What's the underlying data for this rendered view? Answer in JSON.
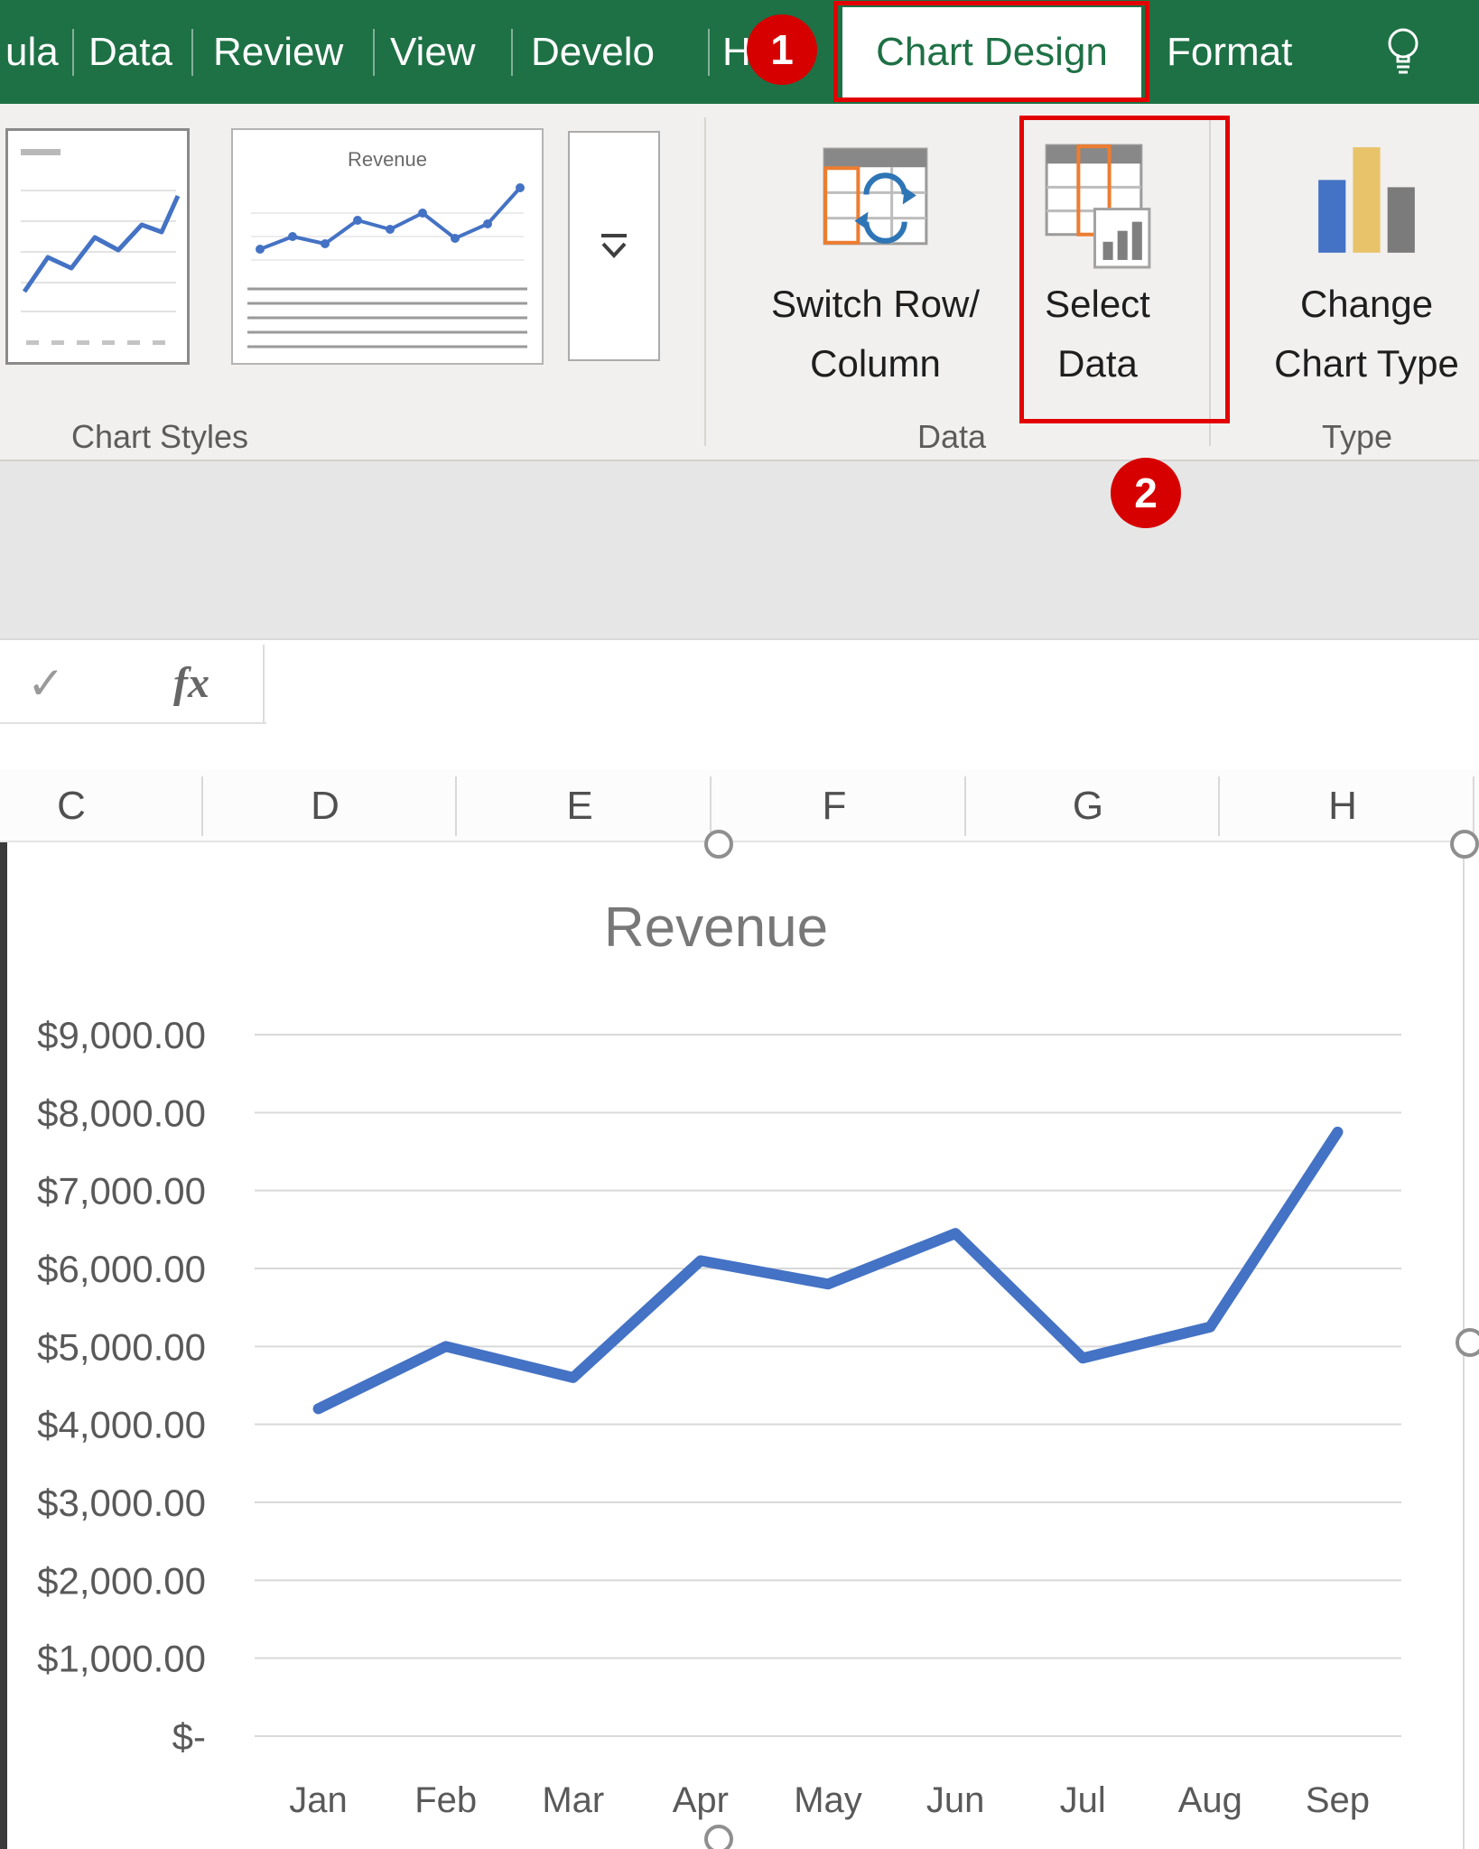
{
  "ribbon": {
    "tabs": {
      "formulas_partial": "ula",
      "data": "Data",
      "review": "Review",
      "view": "View",
      "developer_partial": "Develo",
      "help_partial": "H",
      "chart_design": "Chart Design",
      "format": "Format"
    },
    "annotations": {
      "step1": "1",
      "step2": "2"
    },
    "groups": {
      "chart_styles": {
        "label": "Chart Styles",
        "thumb2_title": "Revenue"
      },
      "data": {
        "label": "Data",
        "switch_row_column": {
          "line1": "Switch Row/",
          "line2": "Column"
        },
        "select_data": {
          "line1": "Select",
          "line2": "Data"
        }
      },
      "type": {
        "label": "Type",
        "change_chart_type": {
          "line1": "Change",
          "line2": "Chart Type"
        }
      }
    }
  },
  "formula_bar": {
    "fx_label": "fx"
  },
  "sheet": {
    "columns": [
      "C",
      "D",
      "E",
      "F",
      "G",
      "H"
    ]
  },
  "chart_data": {
    "type": "line",
    "title": "Revenue",
    "categories": [
      "Jan",
      "Feb",
      "Mar",
      "Apr",
      "May",
      "Jun",
      "Jul",
      "Aug",
      "Sep"
    ],
    "series": [
      {
        "name": "Revenue",
        "values": [
          4200,
          5000,
          4600,
          6100,
          5800,
          6450,
          4850,
          5250,
          7750
        ]
      }
    ],
    "ylim": [
      0,
      9000
    ],
    "ytick_step": 1000,
    "ytick_labels": [
      "$-",
      "$1,000.00",
      "$2,000.00",
      "$3,000.00",
      "$4,000.00",
      "$5,000.00",
      "$6,000.00",
      "$7,000.00",
      "$8,000.00",
      "$9,000.00"
    ],
    "xlabel": "",
    "ylabel": "",
    "grid": true,
    "legend": "none",
    "line_color": "#4472c4"
  },
  "colors": {
    "excel_green": "#1e7145",
    "annotation_red": "#d60000",
    "series_blue": "#4472c4"
  }
}
